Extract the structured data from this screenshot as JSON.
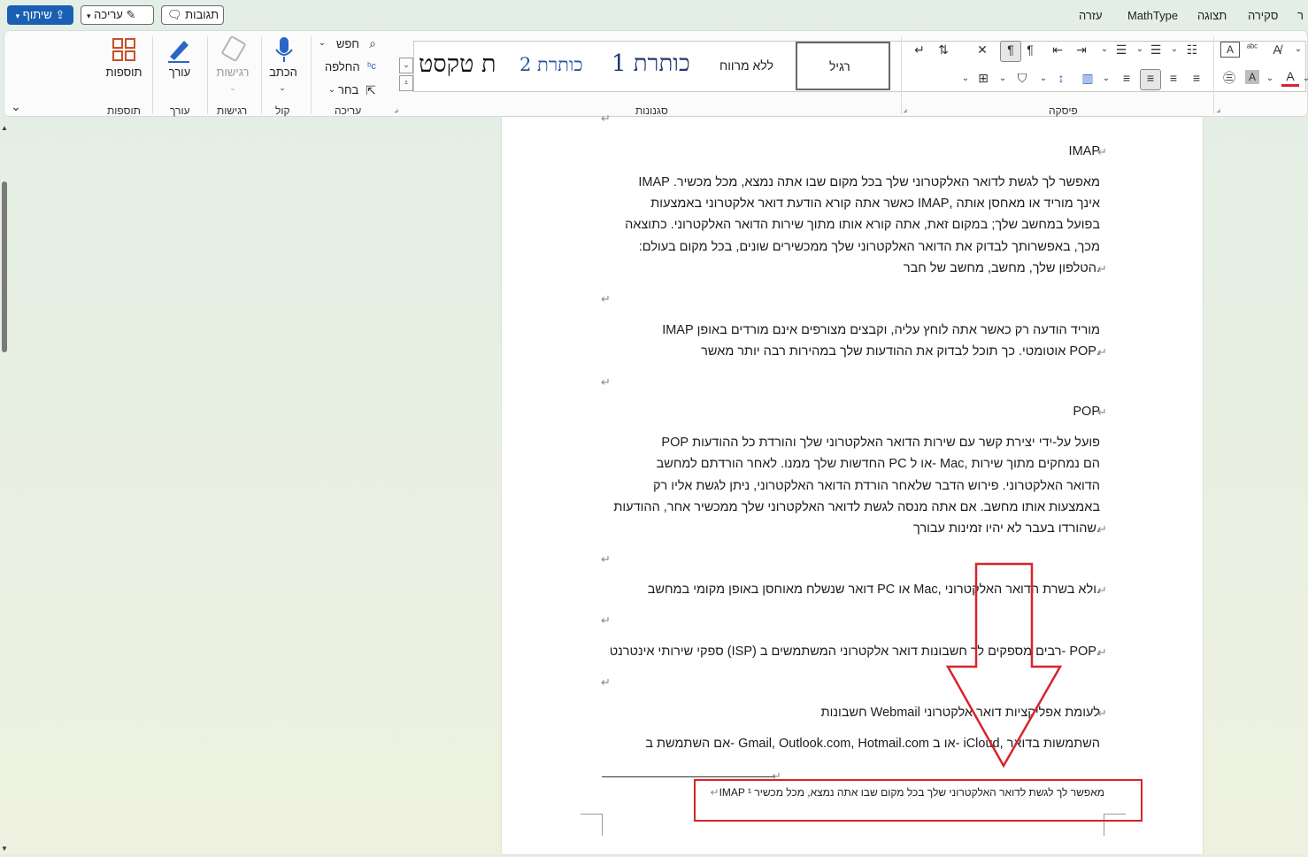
{
  "top_bar": {
    "menu_tabs": [
      "ר",
      "סקירה",
      "תצוגה",
      "MathType",
      "עזרה"
    ],
    "comments_button": "תגובות",
    "edit_mode_button": "עריכה",
    "share_button": "שיתוף"
  },
  "ribbon": {
    "groups": {
      "addins": {
        "label": "תוספות",
        "button": "תוספות"
      },
      "editor": {
        "label": "עורך",
        "button": "עורך"
      },
      "sensitivity": {
        "label": "רגישות",
        "button": "רגישות"
      },
      "voice": {
        "label": "קול",
        "button": "הכתב"
      },
      "editing": {
        "label": "עריכה",
        "find": "חפש",
        "replace": "החלפה",
        "select": "בחר"
      },
      "styles": {
        "label": "סגנונות",
        "items": [
          "רגיל",
          "ללא מרווח",
          "כותרת 1",
          "כותרת 2",
          "ת טקסט"
        ]
      },
      "paragraph": {
        "label": "פיסקה"
      }
    }
  },
  "document": {
    "lines": [
      {
        "text": "IMAP",
        "ret": true
      },
      {
        "text": "מאפשר לך לגשת לדואר האלקטרוני שלך בכל מקום שבו אתה נמצא, מכל מכשיר.  IMAP"
      },
      {
        "text": "אינך מוריד או מאחסן אותה  ,IMAP  כאשר אתה קורא הודעת דואר אלקטרוני באמצעות"
      },
      {
        "text": "בפועל במחשב שלך; במקום זאת, אתה קורא אותו מתוך שירות הדואר האלקטרוני. כתוצאה"
      },
      {
        "text": "מכך, באפשרותך לבדוק את הדואר האלקטרוני שלך ממכשירים שונים, בכל מקום בעולם:"
      },
      {
        "text": ".הטלפון שלך, מחשב, מחשב של חבר",
        "ret": true
      },
      {
        "text": "",
        "ret": true
      },
      {
        "text": "מוריד הודעה רק כאשר אתה לוחץ עליה, וקבצים מצורפים אינם מורדים באופן  IMAP"
      },
      {
        "text": ".POP  אוטומטי. כך תוכל לבדוק את ההודעות שלך במהירות רבה יותר מאשר",
        "ret": true
      },
      {
        "text": "",
        "ret": true
      },
      {
        "text": "POP",
        "ret": true
      },
      {
        "text": "פועל על-ידי יצירת קשר עם שירות הדואר האלקטרוני שלך והורדת כל ההודעות  POP"
      },
      {
        "text": "הם נמחקים מתוך שירות  ,Mac -או ל  PC  החדשות שלך ממנו. לאחר הורדתם למחשב"
      },
      {
        "text": "הדואר האלקטרוני. פירוש הדבר שלאחר הורדת הדואר האלקטרוני, ניתן לגשת אליו רק"
      },
      {
        "text": "באמצעות אותו מחשב. אם אתה מנסה לגשת לדואר האלקטרוני שלך ממכשיר אחר, ההודעות"
      },
      {
        "text": ".שהורדו בעבר לא יהיו זמינות עבורך",
        "ret": true
      },
      {
        "text": "",
        "ret": true
      },
      {
        "text": ".ולא בשרת הדואר האלקטרוני  ,Mac  או  PC  דואר שנשלח מאוחסן באופן מקומי במחשב",
        "ret": true
      },
      {
        "text": "",
        "ret": true
      },
      {
        "text": ".POP -רבים מספקים לך חשבונות דואר אלקטרוני המשתמשים ב  (ISP)  ספקי שירותי אינטרנט",
        "ret": true
      },
      {
        "text": "",
        "ret": true
      },
      {
        "text": "לעומת אפליקציות דואר אלקטרוני  Webmail  חשבונות",
        "ret": true
      },
      {
        "text": "השתמשות בדואר  ,iCloud -או ב  Gmail, Outlook.com, Hotmail.com -אם השתמשת ב"
      }
    ],
    "footnote": "מאפשר לך לגשת לדואר האלקטרוני שלך בכל מקום שבו אתה נמצא, מכל מכשיר  IMAP  ¹"
  },
  "colors": {
    "accent": "#1a5fb4",
    "annotation": "#d9232b"
  }
}
